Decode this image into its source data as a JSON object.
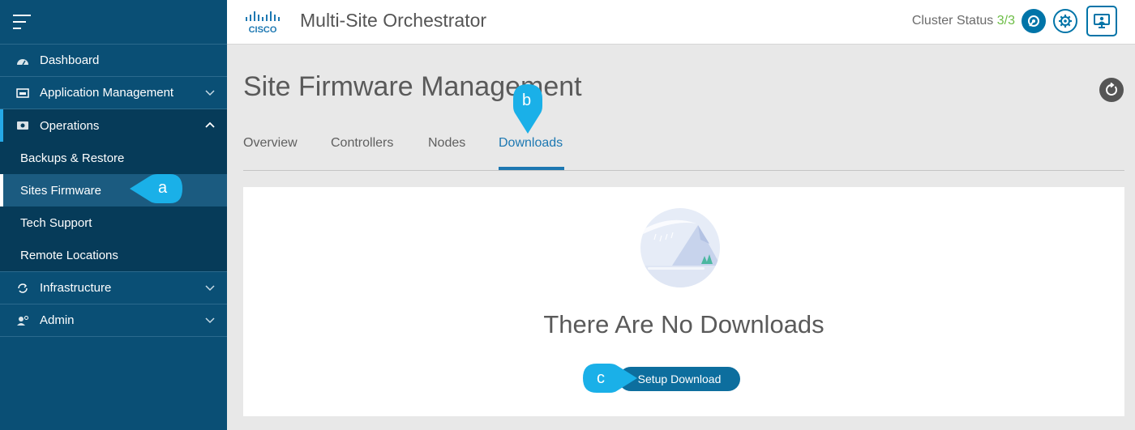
{
  "sidebar": {
    "items": [
      {
        "label": "Dashboard",
        "icon": "dashboard-icon"
      },
      {
        "label": "Application Management",
        "icon": "app-management-icon"
      },
      {
        "label": "Operations",
        "icon": "operations-icon"
      },
      {
        "label": "Infrastructure",
        "icon": "infrastructure-icon"
      },
      {
        "label": "Admin",
        "icon": "admin-icon"
      }
    ],
    "operations_sub": [
      {
        "label": "Backups & Restore"
      },
      {
        "label": "Sites Firmware"
      },
      {
        "label": "Tech Support"
      },
      {
        "label": "Remote Locations"
      }
    ]
  },
  "header": {
    "logo_text": "CISCO",
    "title": "Multi-Site Orchestrator",
    "cluster_label": "Cluster Status",
    "cluster_value": "3/3"
  },
  "page": {
    "title": "Site Firmware Management",
    "tabs": [
      {
        "label": "Overview"
      },
      {
        "label": "Controllers"
      },
      {
        "label": "Nodes"
      },
      {
        "label": "Downloads"
      }
    ],
    "active_tab": "Downloads",
    "empty_title": "There Are No Downloads",
    "setup_button": "Setup Download"
  },
  "callouts": {
    "a": "a",
    "b": "b",
    "c": "c"
  },
  "colors": {
    "sidebar": "#0a4f75",
    "accent": "#1d78b2",
    "cluster_ok": "#6cbd45",
    "callout": "#1ab0e8"
  }
}
